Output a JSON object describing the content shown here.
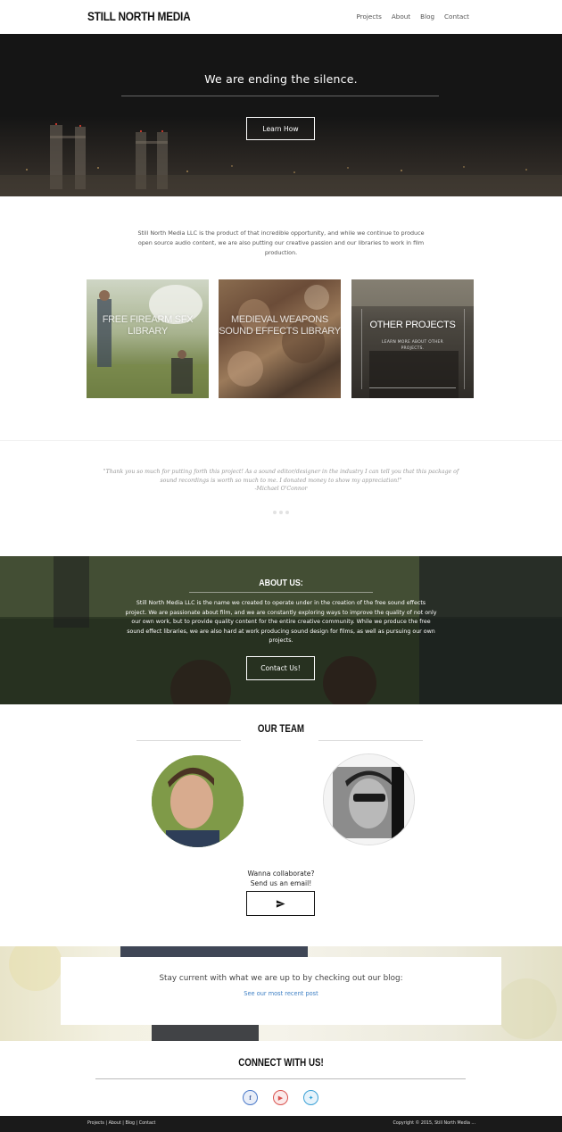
{
  "header": {
    "logo": "STILL NORTH MEDIA",
    "nav": [
      "Projects",
      "About",
      "Blog",
      "Contact"
    ]
  },
  "hero": {
    "title": "We are ending the silence.",
    "button": "Learn How"
  },
  "intro": {
    "text": "Still North Media LLC is the product of that incredible opportunity, and while we continue to produce open source audio content, we are also putting our creative passion and our libraries to work in film production."
  },
  "tiles": [
    {
      "title": "FREE FIREARM SFX LIBRARY"
    },
    {
      "title": "MEDIEVAL WEAPONS SOUND EFFECTS LIBRARY"
    },
    {
      "title": "OTHER PROJECTS",
      "subtitle": "LEARN MORE ABOUT OTHER PROJECTS."
    }
  ],
  "testimonial": {
    "quote": "\"Thank you so much for putting forth this project! As a sound editor/designer in the industry I can tell you that this package of sound recordings is worth so much to me. I donated money to show my appreciation!\"",
    "author": "-Michael O'Connor"
  },
  "about": {
    "title": "ABOUT US:",
    "text": "Still North Media LLC is the name we created to operate under in the creation of the free sound effects project. We are passionate about film, and we are constantly exploring ways to improve the quality of not only our own work, but to provide quality content for the entire creative community. While we produce the free sound effect libraries, we are also hard at work producing sound design for films, as well as pursuing our own projects.",
    "button": "Contact Us!"
  },
  "team": {
    "title": "OUR TEAM",
    "collab_line1": "Wanna collaborate?",
    "collab_line2": "Send us an email!"
  },
  "blog": {
    "text": "Stay current with what we are up to by checking out our blog:",
    "link": "See our most recent post"
  },
  "connect": {
    "title": "CONNECT WITH US!",
    "facebook": "f",
    "youtube": "▶",
    "twitter": "✦"
  },
  "footer": {
    "links": [
      "Projects",
      "About",
      "Blog",
      "Contact"
    ],
    "separator": " | ",
    "copyright": "Copyright © 2015, Still North Media ..."
  },
  "colors": {
    "link": "#3d7fc4",
    "footer_bg": "#1a1a1a",
    "hero_bg": "#151515"
  }
}
